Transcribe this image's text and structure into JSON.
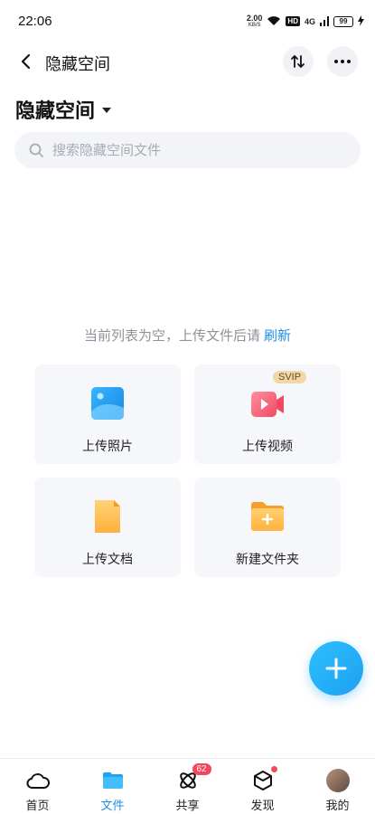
{
  "status_bar": {
    "time": "22:06",
    "net_speed_value": "2.00",
    "net_speed_unit": "KB/S",
    "hd_label": "HD",
    "signal_label": "4G",
    "battery_level": "99"
  },
  "header": {
    "title": "隐藏空间"
  },
  "space": {
    "title": "隐藏空间"
  },
  "search": {
    "placeholder": "搜索隐藏空间文件",
    "value": ""
  },
  "empty_state": {
    "message": "当前列表为空，上传文件后请",
    "refresh_label": "刷新"
  },
  "actions": {
    "upload_photo": "上传照片",
    "upload_video": "上传视频",
    "upload_video_badge": "SVIP",
    "upload_doc": "上传文档",
    "new_folder": "新建文件夹"
  },
  "tabs": {
    "home": "首页",
    "files": "文件",
    "share": "共享",
    "share_badge": "62",
    "discover": "发现",
    "mine": "我的"
  },
  "colors": {
    "accent": "#1f8fe8",
    "badge": "#f2485d"
  }
}
